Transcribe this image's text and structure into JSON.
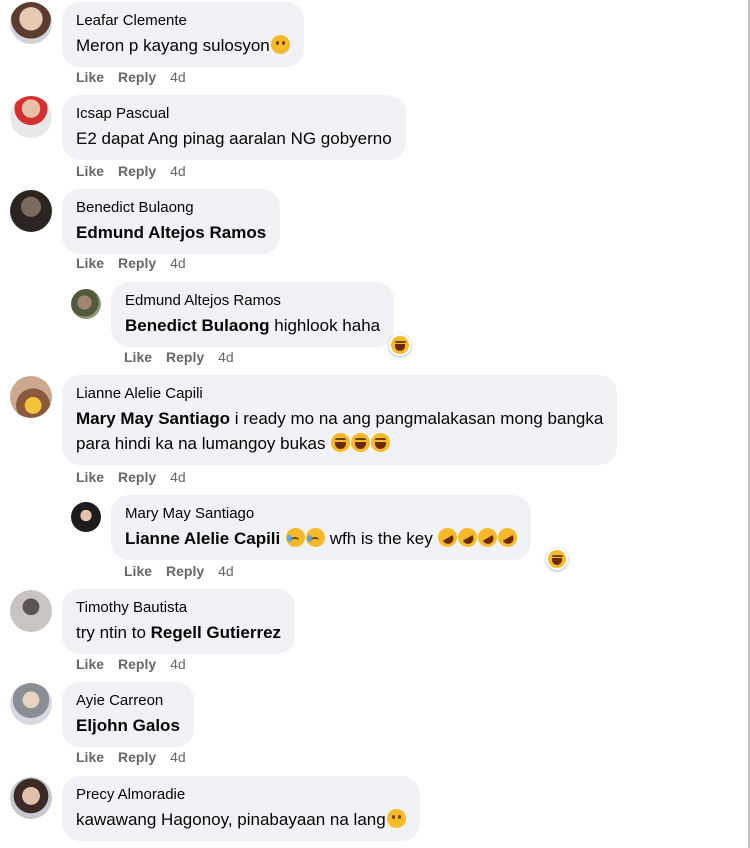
{
  "actions": {
    "like": "Like",
    "reply": "Reply"
  },
  "comments": [
    {
      "author": "Leafar Clemente",
      "text": "Meron p kayang sulosyon",
      "time": "4d"
    },
    {
      "author": "Icsap Pascual",
      "text": "E2 dapat Ang pinag aaralan NG gobyerno",
      "time": "4d"
    },
    {
      "author": "Benedict Bulaong",
      "mention": "Edmund Altejos Ramos",
      "time": "4d"
    },
    {
      "author": "Edmund Altejos Ramos",
      "mention": "Benedict Bulaong",
      "text": "highlook haha",
      "time": "4d",
      "reaction": "laugh"
    },
    {
      "author": "Lianne Alelie Capili",
      "mention": "Mary May Santiago",
      "text": "i ready mo na ang pangmalakasan mong bangka",
      "text2": "para hindi ka na lumangoy bukas",
      "time": "4d"
    },
    {
      "author": "Mary May Santiago",
      "mention": "Lianne Alelie Capili",
      "text": "wfh is the key",
      "time": "4d",
      "reaction": "laugh"
    },
    {
      "author": "Timothy Bautista",
      "text": "try ntin to",
      "mention": "Regell Gutierrez",
      "time": "4d"
    },
    {
      "author": "Ayie Carreon",
      "mention": "Eljohn Galos",
      "time": "4d"
    },
    {
      "author": "Precy Almoradie",
      "text": "kawawang Hagonoy, pinabayaan na lang",
      "time": ""
    }
  ],
  "colors": {
    "bubble": "#f0f2f5",
    "meta": "#65676b",
    "emoji": "#f7b928"
  }
}
